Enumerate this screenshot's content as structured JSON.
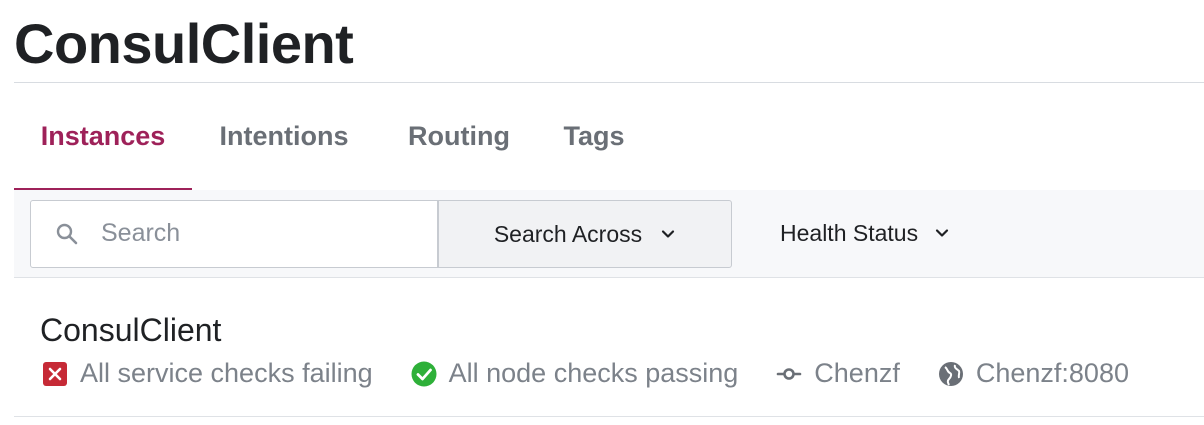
{
  "page": {
    "title": "ConsulClient"
  },
  "tabs": [
    {
      "label": "Instances",
      "active": true
    },
    {
      "label": "Intentions",
      "active": false
    },
    {
      "label": "Routing",
      "active": false
    },
    {
      "label": "Tags",
      "active": false
    }
  ],
  "filters": {
    "search_placeholder": "Search",
    "search_value": "",
    "search_across_label": "Search Across",
    "health_status_label": "Health Status"
  },
  "instances": [
    {
      "name": "ConsulClient",
      "service_checks": "All service checks failing",
      "node_checks": "All node checks passing",
      "node": "Chenzf",
      "address": "Chenzf:8080"
    }
  ],
  "colors": {
    "accent": "#9e2159",
    "failing": "#c62a36",
    "passing": "#2eb039",
    "muted": "#7c828a"
  },
  "icons": {
    "search": "search-icon",
    "chevron": "chevron-down-icon",
    "failing": "x-square-icon",
    "passing": "check-circle-icon",
    "node": "node-icon",
    "address": "globe-icon"
  }
}
